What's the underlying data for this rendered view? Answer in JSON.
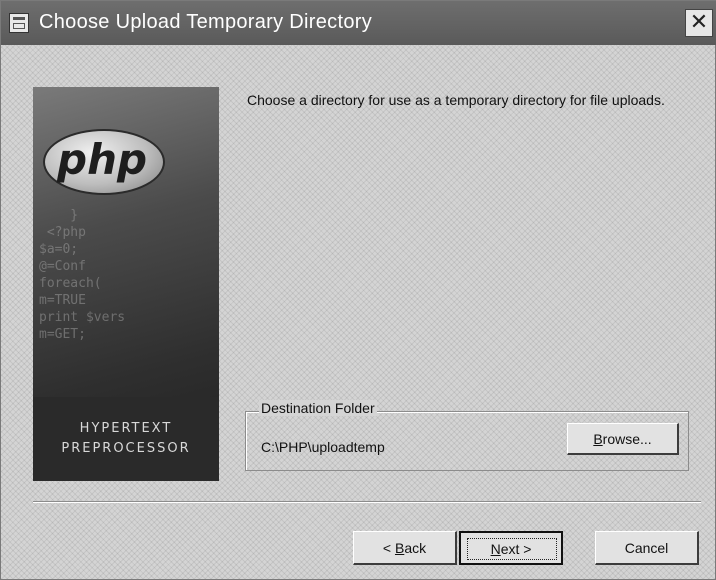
{
  "window": {
    "title": "Choose Upload Temporary Directory",
    "close_glyph": "✕",
    "icon": "installer-window-icon"
  },
  "banner": {
    "logo_text": "php",
    "code_lines": [
      "    }",
      " <?php",
      "$a=0;",
      "@=Conf",
      "foreach(",
      "m=TRUE",
      "print $vers",
      "m=GET;"
    ],
    "footer_line1": "HYPERTEXT",
    "footer_line2": "PREPROCESSOR"
  },
  "main": {
    "instruction": "Choose a directory for use as a temporary directory for file uploads.",
    "destination": {
      "legend": "Destination Folder",
      "path": "C:\\PHP\\uploadtemp",
      "browse_label_accel": "B",
      "browse_label_rest": "rowse..."
    }
  },
  "buttons": {
    "back_prefix": "< ",
    "back_accel": "B",
    "back_rest": "ack",
    "next_accel": "N",
    "next_rest": "ext >",
    "cancel": "Cancel"
  },
  "colors": {
    "titlebar": "#5a5a5a",
    "dialog_bg": "#d4d4d4",
    "banner_dark": "#2a2a2a"
  }
}
